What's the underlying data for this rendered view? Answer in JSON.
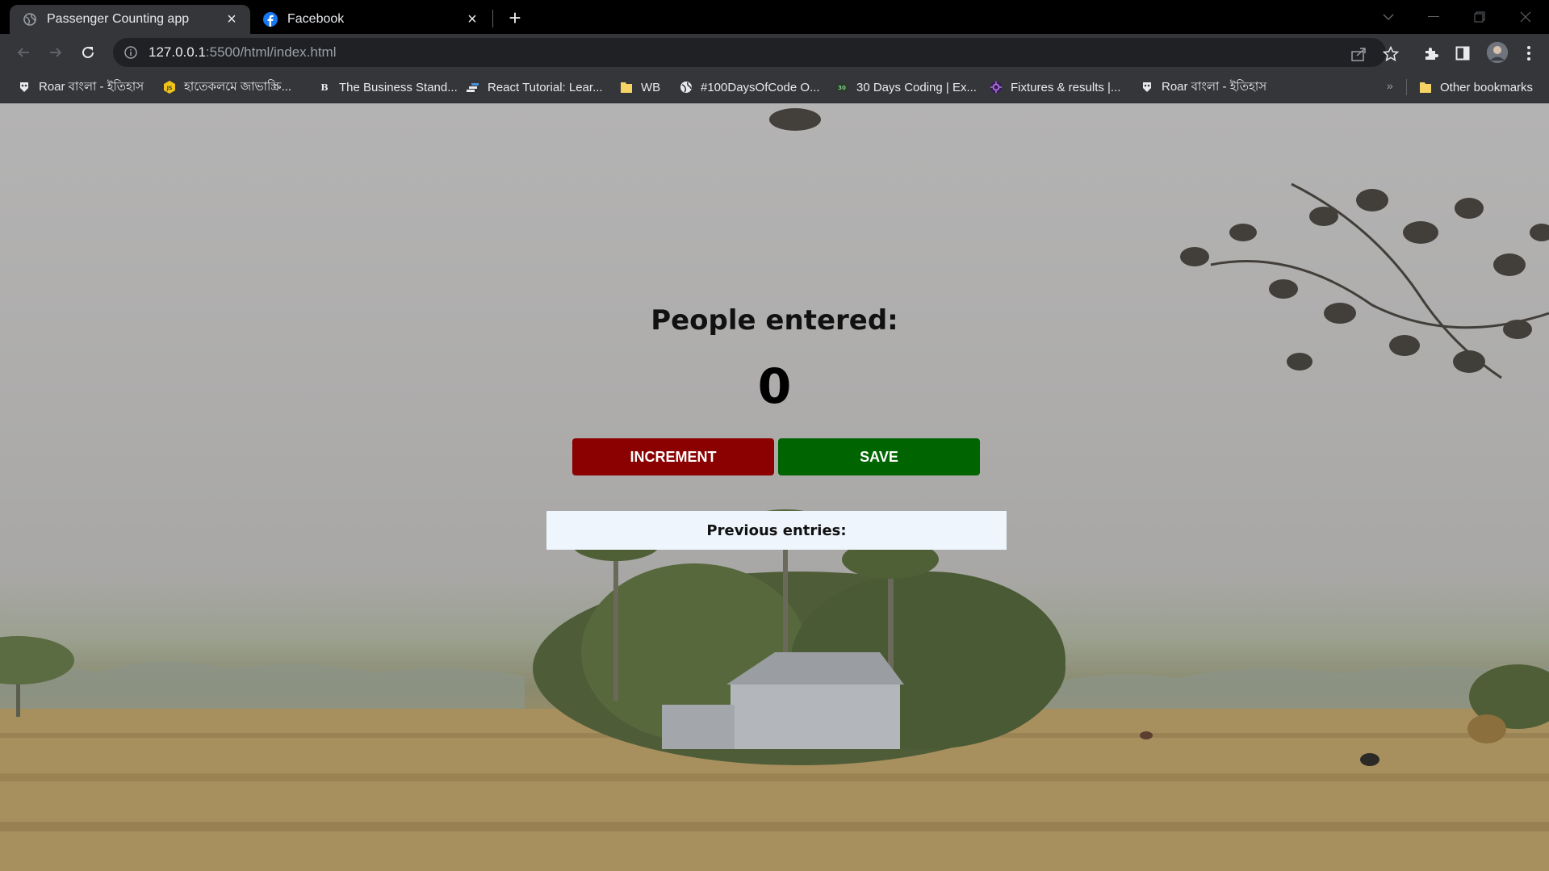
{
  "browser": {
    "tabs": [
      {
        "title": "Passenger Counting app",
        "active": true,
        "icon": "globe-icon"
      },
      {
        "title": "Facebook",
        "active": false,
        "icon": "facebook-icon"
      }
    ],
    "address": {
      "host": "127.0.0.1",
      "path": ":5500/html/index.html"
    },
    "bookmarks": [
      {
        "label": "Roar বাংলা - ইতিহাস",
        "icon": "roar-icon"
      },
      {
        "label": "হাতেকলমে জাভাস্ক্রি...",
        "icon": "js-icon"
      },
      {
        "label": "The Business Stand...",
        "icon": "tbs-icon"
      },
      {
        "label": "React Tutorial: Lear...",
        "icon": "react-tutorial-icon"
      },
      {
        "label": "WB",
        "icon": "folder-icon"
      },
      {
        "label": "#100DaysOfCode O...",
        "icon": "globe-icon"
      },
      {
        "label": "30 Days Coding | Ex...",
        "icon": "thirty-days-icon"
      },
      {
        "label": "Fixtures & results |...",
        "icon": "fixtures-icon"
      },
      {
        "label": "Roar বাংলা - ইতিহাস",
        "icon": "roar-icon"
      }
    ],
    "other_bookmarks": "Other bookmarks"
  },
  "app": {
    "heading": "People entered:",
    "count": "0",
    "increment_label": "INCREMENT",
    "save_label": "SAVE",
    "previous_entries": "Previous entries:"
  },
  "colors": {
    "increment": "#8b0000",
    "save": "#006400",
    "entries_bg": "#eef5fc"
  }
}
